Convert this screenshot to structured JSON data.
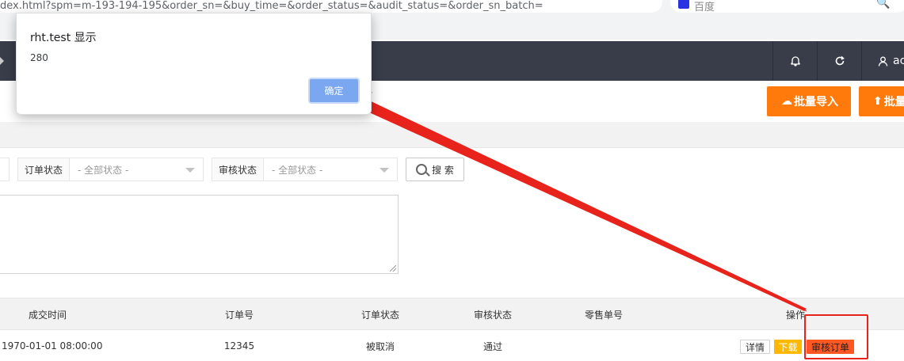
{
  "browser": {
    "url": "dex.html?spm=m-193-194-195&order_sn=&buy_time=&order_status=&audit_status=&order_sn_batch=",
    "search_engine": "百度"
  },
  "header": {
    "user_label": "ac"
  },
  "toolbar": {
    "import_label": "批量导入",
    "batch_label": "批量"
  },
  "filters": {
    "order_status_label": "订单状态",
    "order_status_value": "- 全部状态 -",
    "audit_status_label": "审核状态",
    "audit_status_value": "- 全部状态 -",
    "search_label": "搜 索"
  },
  "table": {
    "columns": [
      "成交时间",
      "订单号",
      "订单状态",
      "审核状态",
      "零售单号",
      "操作"
    ],
    "rows": [
      {
        "time": "1970-01-01 08:00:00",
        "order_no": "12345",
        "order_status": "被取消",
        "audit_status": "通过",
        "retail_no": ""
      }
    ],
    "actions": {
      "detail": "详情",
      "download": "下载",
      "audit": "审核订单"
    }
  },
  "dialog": {
    "title": "rht.test 显示",
    "message": "280",
    "ok_label": "确定"
  },
  "colors": {
    "header_bg": "#393d49",
    "orange_button": "#ff7a0a",
    "download_button": "#ffb800",
    "audit_button": "#ff5722",
    "annotation_red": "#e8231c",
    "dialog_ok": "#7ba7f0"
  }
}
